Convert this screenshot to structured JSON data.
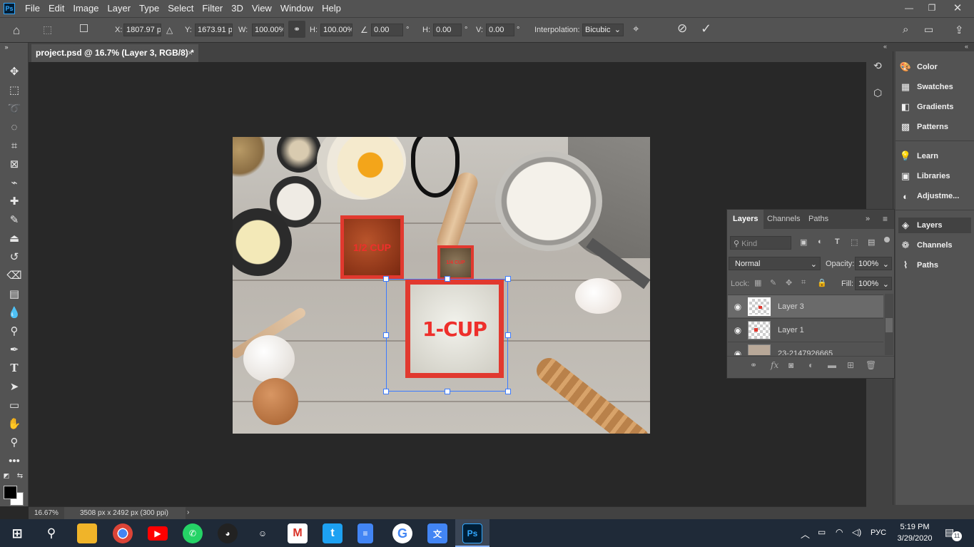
{
  "menubar": {
    "logo": "Ps",
    "items": [
      "File",
      "Edit",
      "Image",
      "Layer",
      "Type",
      "Select",
      "Filter",
      "3D",
      "View",
      "Window",
      "Help"
    ]
  },
  "options": {
    "x_label": "X:",
    "x_value": "1807.97 p:",
    "y_label": "Y:",
    "y_value": "1673.91 p:",
    "w_label": "W:",
    "w_value": "100.00%",
    "h_label": "H:",
    "h_value": "100.00%",
    "angle_value": "0.00",
    "angle_unit": "°",
    "hskew_label": "H:",
    "hskew_value": "0.00",
    "vskew_label": "V:",
    "vskew_value": "0.00",
    "interp_label": "Interpolation:",
    "interp_value": "Bicubic"
  },
  "document": {
    "tab_title": "project.psd @ 16.7% (Layer 3, RGB/8) *",
    "close": "×"
  },
  "artwork": {
    "label_half_cup": "1/2 CUP",
    "label_small": "1/4 CUP",
    "label_one_cup": "1-CUP"
  },
  "status": {
    "zoom": "16.67%",
    "doc_size": "3508 px x 2492 px (300 ppi)",
    "arrow": "›"
  },
  "panels": {
    "items": [
      {
        "label": "Color",
        "icon": "palette-icon"
      },
      {
        "label": "Swatches",
        "icon": "grid-icon"
      },
      {
        "label": "Gradients",
        "icon": "gradient-icon"
      },
      {
        "label": "Patterns",
        "icon": "pattern-icon"
      },
      {
        "label": "Learn",
        "icon": "lightbulb-icon"
      },
      {
        "label": "Libraries",
        "icon": "library-icon"
      },
      {
        "label": "Adjustme...",
        "icon": "adjust-icon"
      },
      {
        "label": "Layers",
        "icon": "layers-icon"
      },
      {
        "label": "Channels",
        "icon": "channels-icon"
      },
      {
        "label": "Paths",
        "icon": "paths-icon"
      }
    ]
  },
  "layers_panel": {
    "tabs": [
      "Layers",
      "Channels",
      "Paths"
    ],
    "kind_placeholder": "Kind",
    "blend_mode": "Normal",
    "opacity_label": "Opacity:",
    "opacity_value": "100%",
    "lock_label": "Lock:",
    "fill_label": "Fill:",
    "fill_value": "100%",
    "layers": [
      {
        "name": "Layer 3",
        "selected": true
      },
      {
        "name": "Layer 1",
        "selected": false
      },
      {
        "name": "23-2147926665",
        "selected": false
      }
    ]
  },
  "taskbar": {
    "lang": "РУС",
    "time": "5:19 PM",
    "date": "3/29/2020",
    "notif_count": "11"
  }
}
